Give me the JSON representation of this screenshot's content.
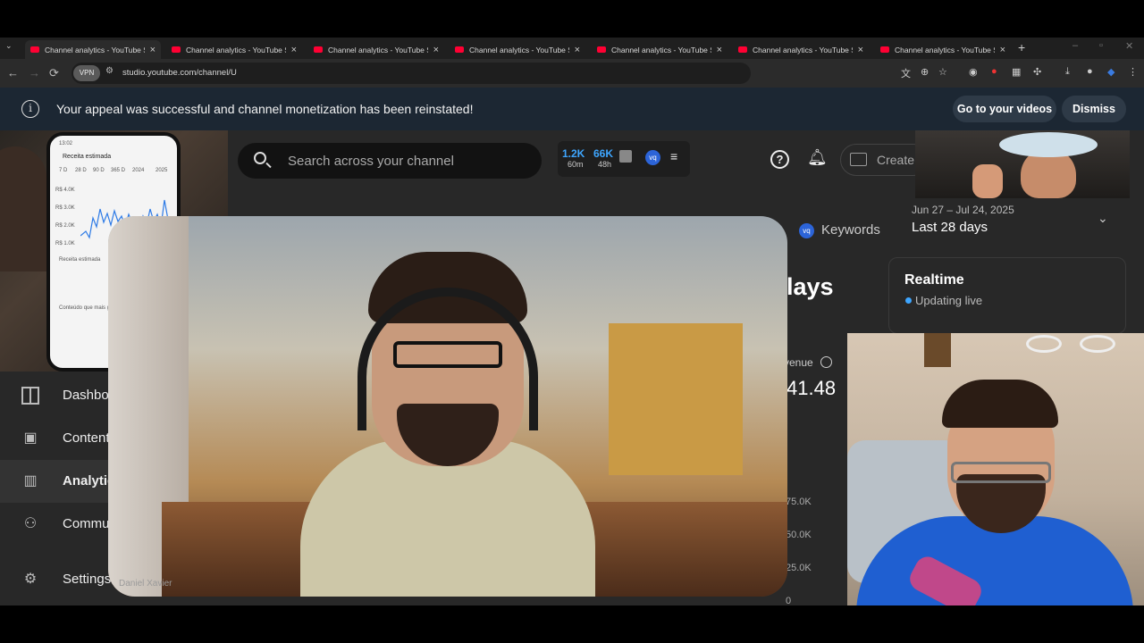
{
  "browser": {
    "tabs": [
      {
        "title": "Channel analytics - YouTube Studio",
        "active": true
      },
      {
        "title": "Channel analytics - YouTube Studio",
        "active": false
      },
      {
        "title": "Channel analytics - YouTube Studio",
        "active": false
      },
      {
        "title": "Channel analytics - YouTube Studio",
        "active": false
      },
      {
        "title": "Channel analytics - YouTube Studio",
        "active": false
      },
      {
        "title": "Channel analytics - YouTube Studio",
        "active": false
      },
      {
        "title": "Channel analytics - YouTube Studio",
        "active": false
      }
    ],
    "vpn_label": "VPN",
    "url": "studio.youtube.com/channel/U",
    "icons": {
      "back": "back-arrow-icon",
      "forward": "forward-arrow-icon",
      "reload": "reload-icon",
      "translate": "translate-icon",
      "zoom": "zoom-icon",
      "bookmark": "star-icon",
      "download": "download-icon",
      "menu": "kebab-menu-icon"
    }
  },
  "banner": {
    "message": "Your appeal was successful and channel monetization has been reinstated!",
    "go_to_videos": "Go to your videos",
    "dismiss": "Dismiss"
  },
  "header": {
    "search_placeholder": "Search across your channel",
    "stats": {
      "views_value": "1.2K",
      "views_period": "60m",
      "subs_value": "66K",
      "subs_period": "48h"
    },
    "create_label": "Create"
  },
  "nav": {
    "items": [
      {
        "label": "Dashboard",
        "icon": "dashboard-icon"
      },
      {
        "label": "Content",
        "icon": "content-icon"
      },
      {
        "label": "Analytics",
        "icon": "analytics-icon",
        "active": true
      },
      {
        "label": "Community",
        "icon": "community-icon"
      },
      {
        "label": "Settings",
        "icon": "gear-icon"
      }
    ]
  },
  "analytics": {
    "keywords_tab": "Keywords",
    "date_range": "Jun 27 – Jul 24, 2025",
    "date_label": "Last 28 days",
    "heading_fragment": "lays",
    "revenue_label": "venue",
    "revenue_value": "41.48",
    "y_ticks": [
      "75.0K",
      "50.0K",
      "25.0K",
      "0"
    ],
    "realtime": {
      "title": "Realtime",
      "status": "Updating live"
    }
  },
  "phone_screen": {
    "time": "13:02",
    "title": "Receita estimada",
    "ranges": [
      "7 D",
      "28 D",
      "90 D",
      "365 D",
      "2024",
      "2025"
    ],
    "y_axis": [
      "R$ 4.0K",
      "R$ 3.0K",
      "R$ 2.0K",
      "R$ 1.0K"
    ],
    "bullet_1": "Receita estimada",
    "section": "Conteúdo que mais gerou"
  },
  "video": {
    "speaker_name": "Daniel Xavier",
    "progress": 0.15
  },
  "colors": {
    "accent": "#3ea6ff",
    "youtube_red": "#ff0033",
    "vidiq_blue": "#2c64d8",
    "banner_bg": "#1c2733"
  }
}
